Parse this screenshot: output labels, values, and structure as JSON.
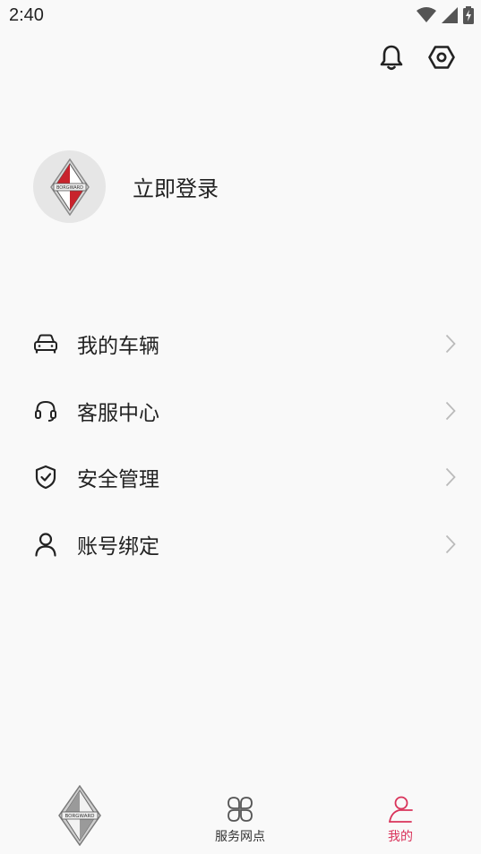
{
  "status": {
    "time": "2:40"
  },
  "profile": {
    "login_label": "立即登录"
  },
  "menu": [
    {
      "label": "我的车辆",
      "icon": "car-icon"
    },
    {
      "label": "客服中心",
      "icon": "headset-icon"
    },
    {
      "label": "安全管理",
      "icon": "shield-check-icon"
    },
    {
      "label": "账号绑定",
      "icon": "user-icon"
    }
  ],
  "nav": {
    "home": {
      "icon": "borgward-logo-icon"
    },
    "service": {
      "label": "服务网点",
      "icon": "grid-clover-icon"
    },
    "mine": {
      "label": "我的",
      "icon": "person-icon",
      "active_color": "#d9335a"
    }
  },
  "colors": {
    "accent": "#d9335a",
    "background": "#f9f9f9",
    "chevron": "#bbbbbb"
  }
}
